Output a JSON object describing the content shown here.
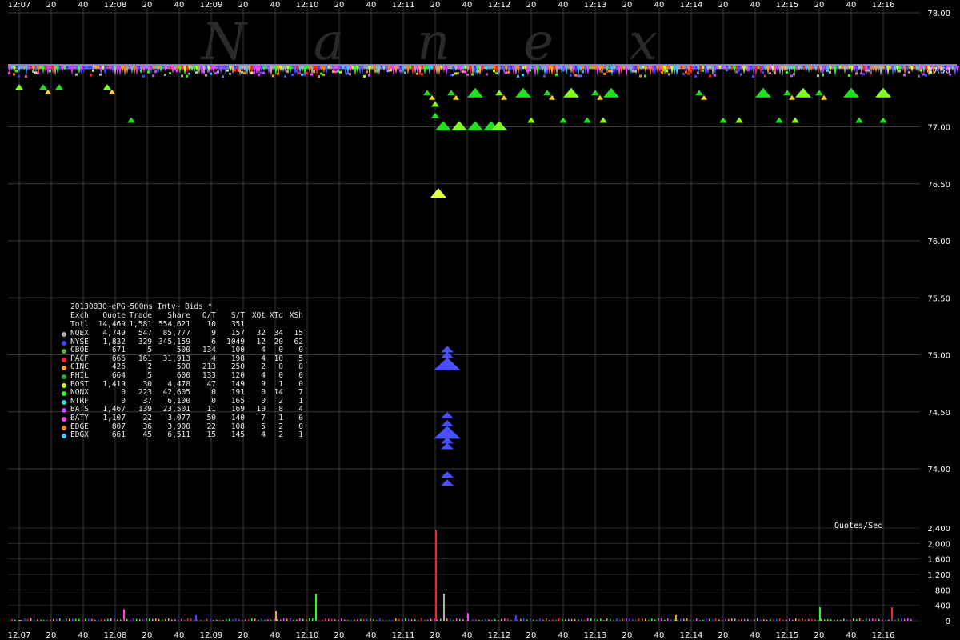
{
  "watermark": [
    "N",
    "a",
    "n",
    "e",
    "x"
  ],
  "qps_label": "Quotes/Sec",
  "x_ticks": [
    "12:07",
    "20",
    "40",
    "12:08",
    "20",
    "40",
    "12:09",
    "20",
    "40",
    "12:10",
    "20",
    "40",
    "12:11",
    "20",
    "40",
    "12:12",
    "20",
    "40",
    "12:13",
    "20",
    "40",
    "12:14",
    "20",
    "40",
    "12:15",
    "20",
    "40",
    "12:16"
  ],
  "legend": {
    "title": "20130830~ePG~500ms Intv~ Bids *",
    "headers": [
      "Exch",
      "Quote",
      "Trade",
      "Share",
      "Q/T",
      "S/T",
      "XQt",
      "XTd",
      "XSh"
    ],
    "total": [
      "Totl",
      "14,469",
      "1,581",
      "554,621",
      "10",
      "351",
      "",
      "",
      ""
    ],
    "rows": [
      {
        "exch": "NQEX",
        "color": "#b0b0b0",
        "vals": [
          "4,749",
          "547",
          "85,777",
          "9",
          "157",
          "32",
          "34",
          "15"
        ]
      },
      {
        "exch": "NYSE",
        "color": "#4040ff",
        "vals": [
          "1,832",
          "329",
          "345,159",
          "6",
          "1049",
          "12",
          "20",
          "62"
        ]
      },
      {
        "exch": "CBOE",
        "color": "#40c040",
        "vals": [
          "671",
          "5",
          "500",
          "134",
          "100",
          "4",
          "0",
          "0"
        ]
      },
      {
        "exch": "PACF",
        "color": "#ff2020",
        "vals": [
          "666",
          "161",
          "31,913",
          "4",
          "198",
          "4",
          "10",
          "5"
        ]
      },
      {
        "exch": "CINC",
        "color": "#ffa020",
        "vals": [
          "426",
          "2",
          "500",
          "213",
          "250",
          "2",
          "0",
          "0"
        ]
      },
      {
        "exch": "PHIL",
        "color": "#20b020",
        "vals": [
          "664",
          "5",
          "600",
          "133",
          "120",
          "4",
          "0",
          "0"
        ]
      },
      {
        "exch": "BOST",
        "color": "#c0ff20",
        "vals": [
          "1,419",
          "30",
          "4,478",
          "47",
          "149",
          "9",
          "1",
          "0"
        ]
      },
      {
        "exch": "NQNX",
        "color": "#20ff20",
        "vals": [
          "0",
          "223",
          "42,605",
          "0",
          "191",
          "0",
          "14",
          "7"
        ]
      },
      {
        "exch": "NTRF",
        "color": "#20e0e0",
        "vals": [
          "0",
          "37",
          "6,100",
          "0",
          "165",
          "0",
          "2",
          "1"
        ]
      },
      {
        "exch": "BATS",
        "color": "#c040ff",
        "vals": [
          "1,467",
          "139",
          "23,501",
          "11",
          "169",
          "10",
          "8",
          "4"
        ]
      },
      {
        "exch": "BATY",
        "color": "#ff40ff",
        "vals": [
          "1,107",
          "22",
          "3,077",
          "50",
          "140",
          "7",
          "1",
          "0"
        ]
      },
      {
        "exch": "EDGE",
        "color": "#ff8000",
        "vals": [
          "807",
          "36",
          "3,900",
          "22",
          "108",
          "5",
          "2",
          "0"
        ]
      },
      {
        "exch": "EDGX",
        "color": "#40c0ff",
        "vals": [
          "661",
          "45",
          "6,511",
          "15",
          "145",
          "4",
          "2",
          "1"
        ]
      }
    ]
  },
  "chart_data": {
    "type": "scatter",
    "title": "",
    "xlabel": "",
    "ylabel": "",
    "x_range": [
      "12:07:00",
      "12:16:50"
    ],
    "price_axis": {
      "ylim": [
        73.6,
        78.0
      ],
      "ticks": [
        "78.00",
        "77.50",
        "77.00",
        "76.50",
        "76.00",
        "75.50",
        "75.00",
        "74.50",
        "74.00"
      ]
    },
    "volume_axis": {
      "ylim": [
        0,
        2400
      ],
      "ticks": [
        "2,400",
        "2,000",
        "1,600",
        "1,200",
        "800",
        "400",
        "0"
      ],
      "label": "Quotes/Sec"
    },
    "grid": true,
    "bid_band": {
      "price_range": [
        77.38,
        77.55
      ],
      "note": "dense multi-exchange bids 12:07-12:16"
    },
    "green_bids": [
      {
        "t": "12:07:00",
        "p": 77.35
      },
      {
        "t": "12:07:15",
        "p": 77.35
      },
      {
        "t": "12:07:25",
        "p": 77.35
      },
      {
        "t": "12:07:55",
        "p": 77.35
      },
      {
        "t": "12:08:10",
        "p": 77.06
      },
      {
        "t": "12:11:15",
        "p": 77.3
      },
      {
        "t": "12:11:20",
        "p": 77.2
      },
      {
        "t": "12:11:20",
        "p": 77.1
      },
      {
        "t": "12:11:25",
        "p": 77.01
      },
      {
        "t": "12:11:35",
        "p": 77.01
      },
      {
        "t": "12:11:45",
        "p": 77.01
      },
      {
        "t": "12:11:55",
        "p": 77.01
      },
      {
        "t": "12:12:00",
        "p": 77.01
      },
      {
        "t": "12:11:30",
        "p": 77.3
      },
      {
        "t": "12:11:45",
        "p": 77.3
      },
      {
        "t": "12:12:00",
        "p": 77.3
      },
      {
        "t": "12:12:15",
        "p": 77.3
      },
      {
        "t": "12:12:30",
        "p": 77.3
      },
      {
        "t": "12:12:45",
        "p": 77.3
      },
      {
        "t": "12:13:00",
        "p": 77.3
      },
      {
        "t": "12:13:10",
        "p": 77.3
      },
      {
        "t": "12:12:20",
        "p": 77.06
      },
      {
        "t": "12:12:40",
        "p": 77.06
      },
      {
        "t": "12:12:55",
        "p": 77.06
      },
      {
        "t": "12:13:05",
        "p": 77.06
      },
      {
        "t": "12:14:05",
        "p": 77.3
      },
      {
        "t": "12:14:20",
        "p": 77.06
      },
      {
        "t": "12:14:30",
        "p": 77.06
      },
      {
        "t": "12:14:45",
        "p": 77.3
      },
      {
        "t": "12:15:00",
        "p": 77.3
      },
      {
        "t": "12:15:10",
        "p": 77.3
      },
      {
        "t": "12:15:20",
        "p": 77.3
      },
      {
        "t": "12:14:55",
        "p": 77.06
      },
      {
        "t": "12:15:05",
        "p": 77.06
      },
      {
        "t": "12:15:40",
        "p": 77.3
      },
      {
        "t": "12:15:45",
        "p": 77.06
      },
      {
        "t": "12:16:00",
        "p": 77.3
      },
      {
        "t": "12:16:00",
        "p": 77.06
      },
      {
        "t": "12:11:22",
        "p": 76.42
      }
    ],
    "nyse_bids": [
      {
        "t": "12:11:22",
        "p": 75.05
      },
      {
        "t": "12:11:22",
        "p": 75.0
      },
      {
        "t": "12:11:22",
        "p": 74.92
      },
      {
        "t": "12:11:22",
        "p": 74.47
      },
      {
        "t": "12:11:22",
        "p": 74.4
      },
      {
        "t": "12:11:22",
        "p": 74.32
      },
      {
        "t": "12:11:22",
        "p": 74.25
      },
      {
        "t": "12:11:22",
        "p": 74.2
      },
      {
        "t": "12:11:22",
        "p": 73.95
      },
      {
        "t": "12:11:22",
        "p": 73.88
      }
    ],
    "quote_rate": [
      {
        "t": "12:07:00",
        "v": 20
      },
      {
        "t": "12:08:05",
        "v": 300
      },
      {
        "t": "12:08:50",
        "v": 150
      },
      {
        "t": "12:09:40",
        "v": 250
      },
      {
        "t": "12:10:05",
        "v": 700
      },
      {
        "t": "12:11:20",
        "v": 2350
      },
      {
        "t": "12:11:25",
        "v": 700
      },
      {
        "t": "12:11:40",
        "v": 200
      },
      {
        "t": "12:12:10",
        "v": 150
      },
      {
        "t": "12:13:50",
        "v": 150
      },
      {
        "t": "12:15:20",
        "v": 350
      },
      {
        "t": "12:16:05",
        "v": 350
      }
    ]
  }
}
